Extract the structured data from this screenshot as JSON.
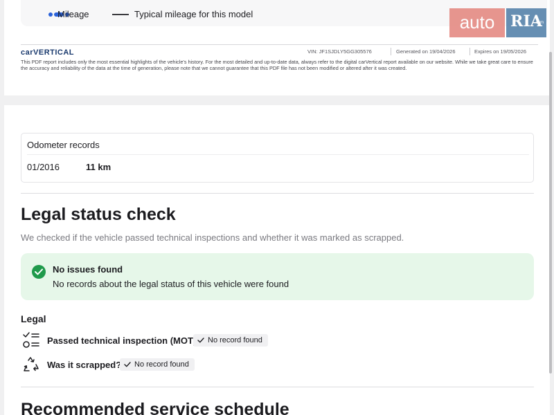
{
  "legend": {
    "mileage": "Mileage",
    "typical": "Typical mileage for this model"
  },
  "carvertical": {
    "logo": "carVERTICAL",
    "vin": "VIN:  JF1SJDLY5GG305576",
    "generated": "Generated on  19/04/2026",
    "expires": "Expires on  19/05/2026",
    "disclaimer": "This PDF report includes only the most essential highlights of the vehicle's history. For the most detailed and up-to-date data, always refer to the digital carVertical report available on our website. While we take great care to ensure the accuracy and reliability of the data at the time of generation, please note that we cannot guarantee that this PDF file has not been modified or altered after it was created."
  },
  "watermark": {
    "auto": "auto",
    "ria": "RIA",
    "domain": ".com"
  },
  "odometer": {
    "title": "Odometer records",
    "records": [
      {
        "date": "01/2016",
        "value": "11 km"
      }
    ]
  },
  "legal": {
    "heading": "Legal status check",
    "subtitle": "We checked if the vehicle passed technical inspections and whether it was marked as scrapped.",
    "result_title": "No issues found",
    "result_text": "No records about the legal status of this vehicle were found",
    "section_label": "Legal",
    "items": [
      {
        "label": "Passed technical inspection (MOT)?",
        "status": "No record found",
        "icon": "checklist-icon"
      },
      {
        "label": "Was it scrapped?",
        "status": "No record found",
        "icon": "recycle-icon"
      }
    ]
  },
  "next_section": {
    "heading": "Recommended service schedule"
  },
  "colors": {
    "success_bg": "#e6f7e9",
    "success_icon": "#1f9a4b",
    "mileage_line": "#2b62d9"
  }
}
